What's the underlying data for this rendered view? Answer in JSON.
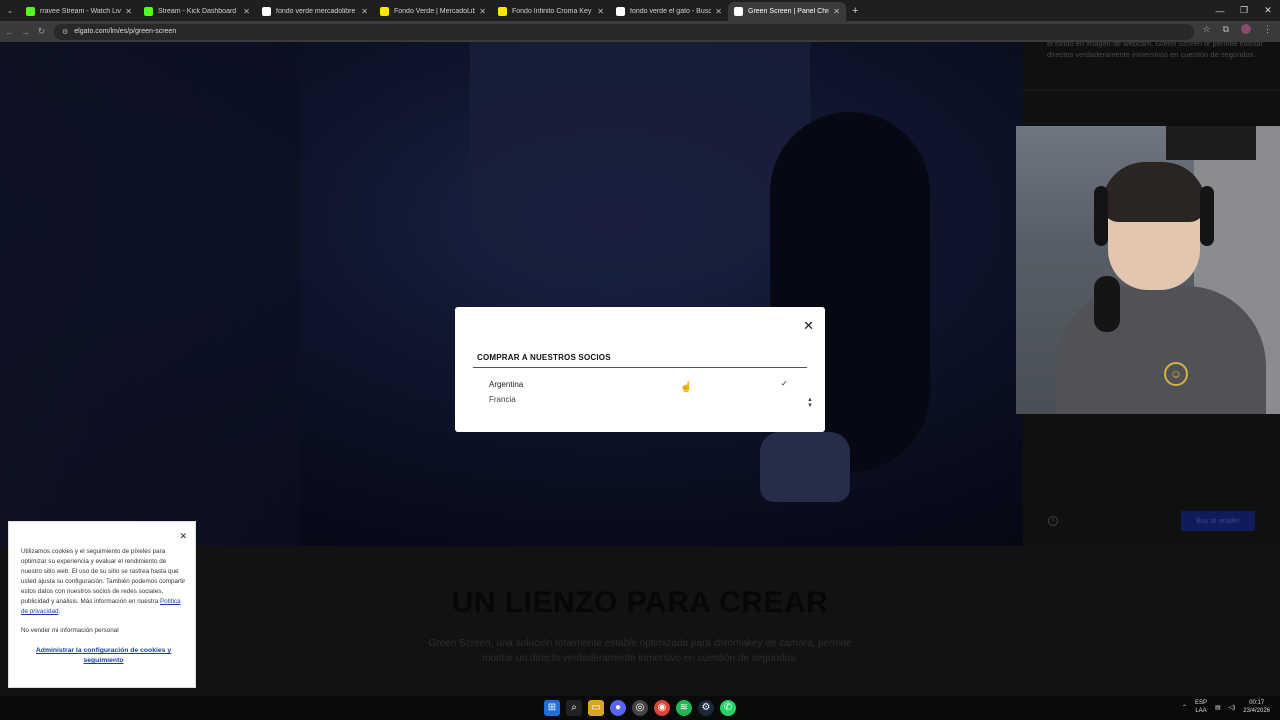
{
  "browser": {
    "tabs": [
      {
        "title": "rravee Stream - Watch Live on",
        "favicon": "kick-icon",
        "color": "#53fc18",
        "active": false
      },
      {
        "title": "Stream - Kick Dashboard",
        "favicon": "kick-icon",
        "color": "#53fc18",
        "active": false
      },
      {
        "title": "fondo verde mercadolibre - Bu",
        "favicon": "google-icon",
        "color": "#ffffff",
        "active": false
      },
      {
        "title": "Fondo Verde | MercadoLibre",
        "favicon": "mercadolibre-icon",
        "color": "#ffe600",
        "active": false
      },
      {
        "title": "Fondo Infinito Croma Key Tela",
        "favicon": "mercadolibre-icon",
        "color": "#ffe600",
        "active": false
      },
      {
        "title": "fondo verde el gato - Buscar c",
        "favicon": "google-icon",
        "color": "#ffffff",
        "active": false
      },
      {
        "title": "Green Screen | Panel Chromakey",
        "favicon": "elgato-icon",
        "color": "#ffffff",
        "active": true
      }
    ],
    "new_tab": "+",
    "url": "elgato.com/lm/es/p/green-screen"
  },
  "page": {
    "side_text": "el fondo en imagen de webcam. Green Screen te permite montar directos verdaderamente inmersivos en cuestión de segundos.",
    "buy_button": "Buy at retailer",
    "section_title": "UN LIENZO PARA CREAR",
    "section_body": "Green Screen, una solución totalmente estable optimizada para chromakey de cámara, permite montar un directo verdaderamente inmersivo en cuestión de segundos."
  },
  "modal": {
    "title": "COMPRAR A NUESTROS SOCIOS",
    "selected_option": "Argentina",
    "next_option": "Francia"
  },
  "cookie": {
    "text": "Utilizamos cookies y el seguimiento de píxeles para optimizar su experiencia y evaluar el rendimiento de nuestro sitio web. El uso de su sitio se rastrea hasta que usted ajusta su configuración. También podemos compartir estos datos con nuestros socios de redes sociales, publicidad y análisis. Más información en nuestra",
    "privacy_link": "Política de privacidad",
    "no_sell": "No vender mi información personal",
    "manage_link": "Administrar la configuración de cookies y seguimiento"
  },
  "taskbar": {
    "lang_top": "ESP",
    "lang_bottom": "LAA",
    "time": "00:17",
    "date": "23/4/2026"
  }
}
